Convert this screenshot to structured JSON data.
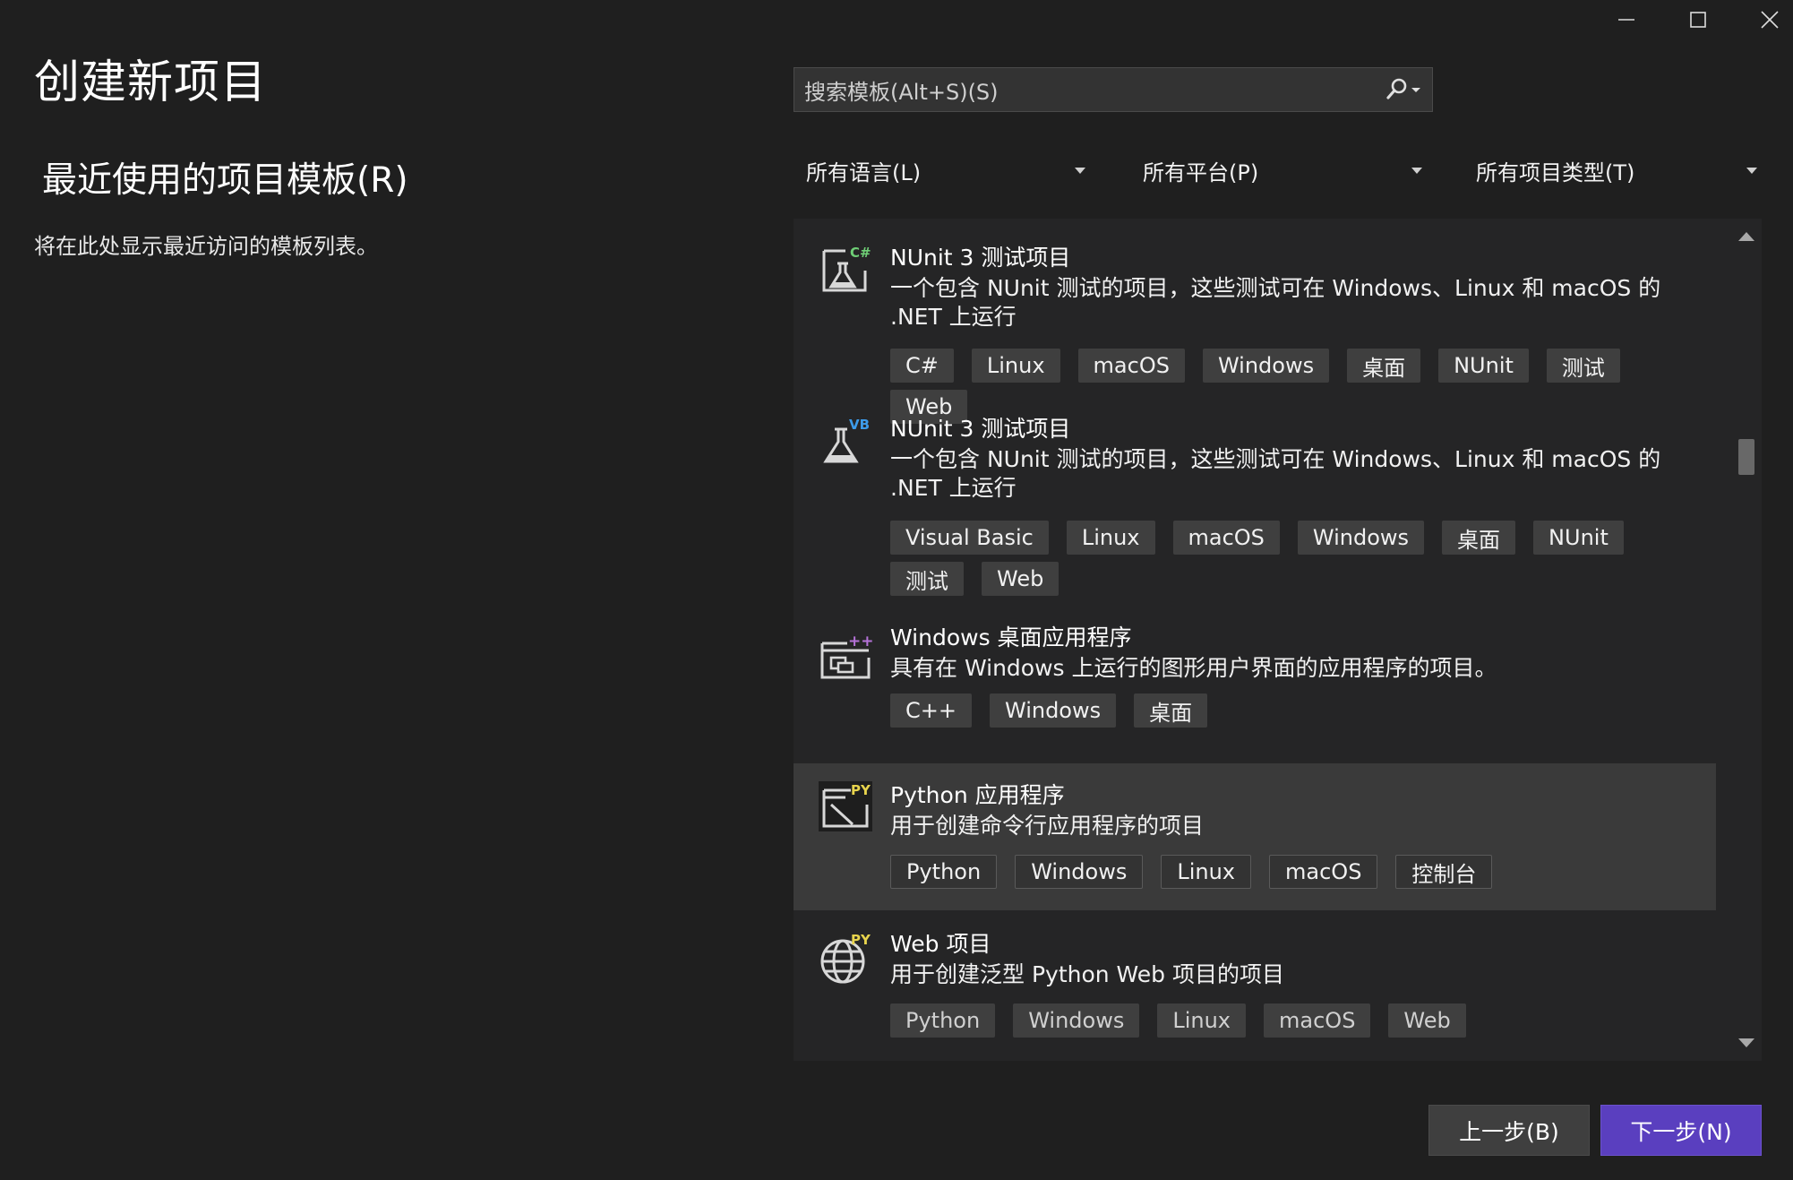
{
  "window": {
    "title": "创建新项目",
    "controls": {
      "minimize": "minimize-icon",
      "maximize": "maximize-icon",
      "close": "close-icon"
    }
  },
  "recent": {
    "title": "最近使用的项目模板(R)",
    "empty_message": "将在此处显示最近访问的模板列表。"
  },
  "search": {
    "placeholder": "搜索模板(Alt+S)(S)",
    "icon": "search-icon"
  },
  "filters": {
    "language": "所有语言(L)",
    "platform": "所有平台(P)",
    "project_type": "所有项目类型(T)"
  },
  "templates": [
    {
      "title": "NUnit 3 测试项目",
      "description": "一个包含 NUnit 测试的项目，这些测试可在 Windows、Linux 和 macOS 的 .NET 上运行",
      "icon": "nunit-csharp-icon",
      "badge": "C#",
      "tags": [
        "C#",
        "Linux",
        "macOS",
        "Windows",
        "桌面",
        "NUnit",
        "测试",
        "Web"
      ]
    },
    {
      "title": "NUnit 3 测试项目",
      "description": "一个包含 NUnit 测试的项目，这些测试可在 Windows、Linux 和 macOS 的 .NET 上运行",
      "icon": "nunit-vb-icon",
      "badge": "VB",
      "tags": [
        "Visual Basic",
        "Linux",
        "macOS",
        "Windows",
        "桌面",
        "NUnit",
        "测试",
        "Web"
      ]
    },
    {
      "title": "Windows 桌面应用程序",
      "description": "具有在 Windows 上运行的图形用户界面的应用程序的项目。",
      "icon": "windows-desktop-cpp-icon",
      "badge": "++",
      "tags": [
        "C++",
        "Windows",
        "桌面"
      ]
    },
    {
      "title": "Python 应用程序",
      "description": "用于创建命令行应用程序的项目",
      "icon": "python-console-icon",
      "badge": "PY",
      "selected": true,
      "tags": [
        "Python",
        "Windows",
        "Linux",
        "macOS",
        "控制台"
      ]
    },
    {
      "title": "Web 项目",
      "description": "用于创建泛型 Python Web 项目的项目",
      "icon": "python-web-globe-icon",
      "badge": "PY",
      "tags": [
        "Python",
        "Windows",
        "Linux",
        "macOS",
        "Web"
      ]
    }
  ],
  "buttons": {
    "back": "上一步(B)",
    "next": "下一步(N)"
  },
  "colors": {
    "background": "#1f1f1f",
    "list_background": "#252526",
    "selected_item": "#3a3a3a",
    "tag_background": "#3f3f3f",
    "primary_button": "#5a3fbf",
    "csharp_badge": "#6fcf76",
    "vb_badge": "#3d9be9",
    "cpp_badge": "#b572d8",
    "python_badge": "#e8d44d"
  }
}
